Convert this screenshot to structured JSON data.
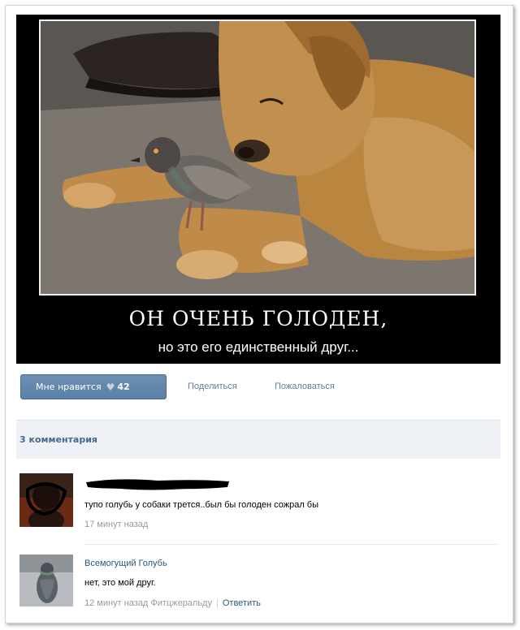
{
  "poster": {
    "title": "ОН ОЧЕНЬ ГОЛОДЕН,",
    "subtitle": "но это его единственный друг..."
  },
  "actions": {
    "like_label": "Мне нравится",
    "like_count": "42",
    "share_label": "Поделиться",
    "report_label": "Пожаловаться"
  },
  "comments_header": "3 комментария",
  "comments": [
    {
      "author": "",
      "text": "тупо голубь у собаки трется..был бы голоден сожрал бы",
      "time": "17 минут назад"
    },
    {
      "author": "Всемогущий Голубь",
      "text": "нет, это мой друг.",
      "time": "12 минут назад Фитцжеральду",
      "reply_label": "Ответить"
    }
  ],
  "colors": {
    "accent": "#5b7fa6",
    "link": "#2b587a",
    "header_bg": "#eef1f5"
  }
}
